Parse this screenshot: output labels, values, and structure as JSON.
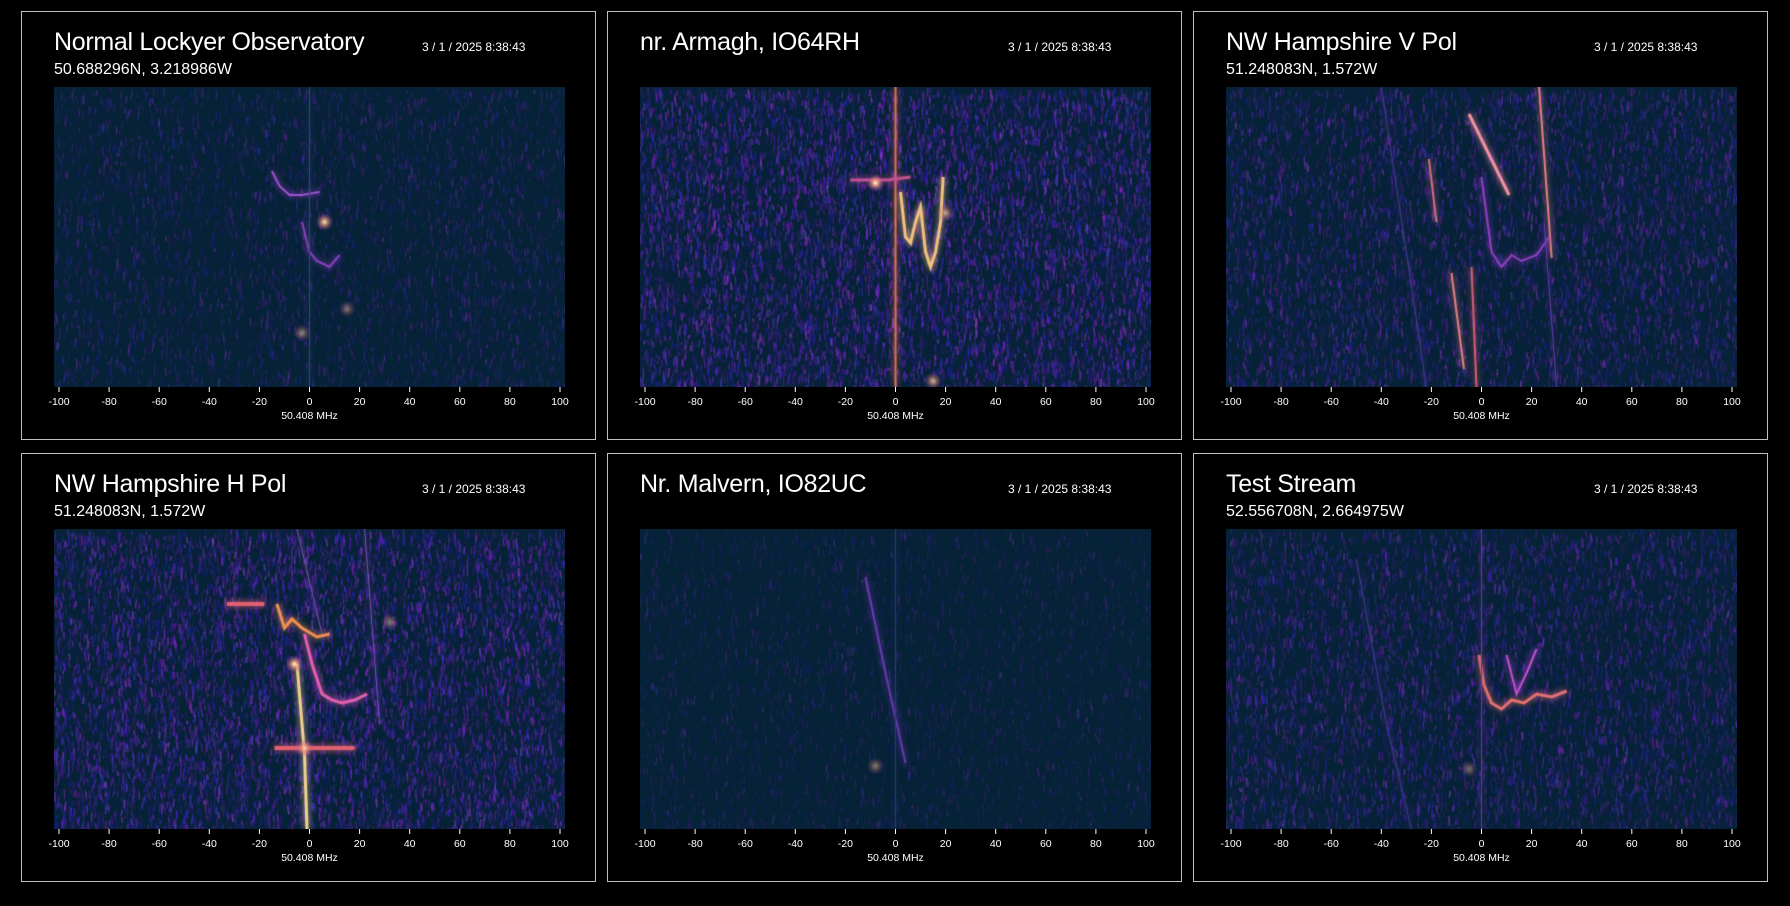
{
  "axis": {
    "ticks": [
      -100,
      -80,
      -60,
      -40,
      -20,
      0,
      20,
      40,
      60,
      80,
      100
    ],
    "xlabel": "50.408 MHz",
    "range": [
      -102,
      102
    ]
  },
  "colors": {
    "background": "#000000",
    "spectrogram_base": "#062236",
    "noise": "#3a2a8a",
    "signal": "#c050e0",
    "hot": "#ffd070"
  },
  "panels": [
    {
      "title": "Normal Lockyer Observatory",
      "coords": "50.688296N, 3.218986W",
      "time": "3 / 1 / 2025  8:38:43",
      "noise_level": 0.25,
      "traces": [
        {
          "points": [
            [
              -15,
              0.28
            ],
            [
              -12,
              0.33
            ],
            [
              -8,
              0.36
            ],
            [
              -3,
              0.36
            ],
            [
              4,
              0.35
            ]
          ],
          "w": 2,
          "c": "#a050d0"
        },
        {
          "points": [
            [
              -3,
              0.45
            ],
            [
              0,
              0.55
            ],
            [
              3,
              0.58
            ],
            [
              8,
              0.6
            ],
            [
              12,
              0.56
            ]
          ],
          "w": 2,
          "c": "#8a40c0"
        },
        {
          "points": [
            [
              0,
              0.0
            ],
            [
              0,
              1.0
            ]
          ],
          "w": 1,
          "c": "#304a7a"
        }
      ],
      "spots": [
        [
          6,
          0.45,
          0.9
        ],
        [
          -3,
          0.82,
          0.5
        ],
        [
          15,
          0.74,
          0.4
        ]
      ]
    },
    {
      "title": "nr. Armagh, IO64RH",
      "coords": "",
      "time": "3 / 1 / 2025  8:38:43",
      "noise_level": 0.9,
      "traces": [
        {
          "points": [
            [
              0,
              0.0
            ],
            [
              0,
              1.0
            ]
          ],
          "w": 2,
          "c": "#e07050"
        },
        {
          "points": [
            [
              2,
              0.35
            ],
            [
              4,
              0.5
            ],
            [
              6,
              0.52
            ],
            [
              8,
              0.45
            ],
            [
              10,
              0.4
            ],
            [
              12,
              0.55
            ],
            [
              14,
              0.6
            ],
            [
              16,
              0.55
            ],
            [
              18,
              0.45
            ],
            [
              19,
              0.3
            ]
          ],
          "w": 3,
          "c": "#f0c080"
        },
        {
          "points": [
            [
              -18,
              0.31
            ],
            [
              -3,
              0.31
            ],
            [
              6,
              0.3
            ]
          ],
          "w": 3,
          "c": "#c05090"
        }
      ],
      "spots": [
        [
          -8,
          0.32,
          1.0
        ],
        [
          20,
          0.42,
          0.6
        ],
        [
          15,
          0.98,
          0.7
        ]
      ]
    },
    {
      "title": "NW Hampshire V Pol",
      "coords": "51.248083N, 1.572W",
      "time": "3 / 1 / 2025  8:38:43",
      "noise_level": 0.55,
      "traces": [
        {
          "points": [
            [
              -5,
              0.09
            ],
            [
              11,
              0.36
            ]
          ],
          "w": 3,
          "c": "#f090a0"
        },
        {
          "points": [
            [
              23,
              0.0
            ],
            [
              28,
              0.57
            ]
          ],
          "w": 2,
          "c": "#e08080"
        },
        {
          "points": [
            [
              -21,
              0.24
            ],
            [
              -18,
              0.45
            ]
          ],
          "w": 2,
          "c": "#d07080"
        },
        {
          "points": [
            [
              -12,
              0.62
            ],
            [
              -7,
              0.94
            ]
          ],
          "w": 2,
          "c": "#e08080"
        },
        {
          "points": [
            [
              -4,
              0.6
            ],
            [
              -2,
              1.0
            ]
          ],
          "w": 2,
          "c": "#d06070"
        },
        {
          "points": [
            [
              0,
              0.3
            ],
            [
              4,
              0.55
            ],
            [
              8,
              0.6
            ],
            [
              12,
              0.56
            ],
            [
              16,
              0.58
            ],
            [
              22,
              0.56
            ],
            [
              27,
              0.5
            ]
          ],
          "w": 2,
          "c": "#9040c0"
        },
        {
          "points": [
            [
              -40,
              0.0
            ],
            [
              -30,
              0.55
            ],
            [
              -22,
              1.0
            ]
          ],
          "w": 1,
          "c": "#4a3a9a"
        },
        {
          "points": [
            [
              25,
              0.45
            ],
            [
              30,
              1.0
            ]
          ],
          "w": 1,
          "c": "#6a3ab0"
        }
      ],
      "spots": []
    },
    {
      "title": "NW Hampshire H Pol",
      "coords": "51.248083N, 1.572W",
      "time": "3 / 1 / 2025  8:38:43",
      "noise_level": 0.85,
      "traces": [
        {
          "points": [
            [
              -5,
              0.45
            ],
            [
              -2,
              0.75
            ],
            [
              -1,
              1.0
            ]
          ],
          "w": 3,
          "c": "#f0d090"
        },
        {
          "points": [
            [
              -13,
              0.25
            ],
            [
              -10,
              0.33
            ],
            [
              -7,
              0.3
            ],
            [
              -3,
              0.33
            ],
            [
              3,
              0.36
            ],
            [
              8,
              0.35
            ]
          ],
          "w": 3,
          "c": "#f09050"
        },
        {
          "points": [
            [
              -2,
              0.35
            ],
            [
              1,
              0.45
            ],
            [
              5,
              0.55
            ],
            [
              9,
              0.57
            ],
            [
              13,
              0.58
            ],
            [
              18,
              0.57
            ],
            [
              23,
              0.55
            ]
          ],
          "w": 3,
          "c": "#e060b0"
        },
        {
          "points": [
            [
              -33,
              0.25
            ],
            [
              -18,
              0.25
            ]
          ],
          "w": 4,
          "c": "#e06070"
        },
        {
          "points": [
            [
              -14,
              0.73
            ],
            [
              18,
              0.73
            ]
          ],
          "w": 4,
          "c": "#e06070"
        },
        {
          "points": [
            [
              -5,
              0.0
            ],
            [
              5,
              0.35
            ]
          ],
          "w": 1,
          "c": "#8050b0"
        },
        {
          "points": [
            [
              22,
              0.0
            ],
            [
              28,
              0.65
            ]
          ],
          "w": 1,
          "c": "#8050b0"
        }
      ],
      "spots": [
        [
          -6,
          0.45,
          1.0
        ],
        [
          -2,
          0.73,
          0.8
        ],
        [
          32,
          0.31,
          0.45
        ]
      ]
    },
    {
      "title": "Nr. Malvern, IO82UC",
      "coords": "",
      "time": "3 / 1 / 2025  8:38:43",
      "noise_level": 0.08,
      "traces": [
        {
          "points": [
            [
              -12,
              0.16
            ],
            [
              -4,
              0.48
            ],
            [
              4,
              0.78
            ]
          ],
          "w": 2,
          "c": "#6a3ab0"
        },
        {
          "points": [
            [
              0,
              0.0
            ],
            [
              0,
              1.0
            ]
          ],
          "w": 1,
          "c": "#2a3a7a"
        }
      ],
      "spots": [
        [
          -8,
          0.79,
          0.45
        ]
      ]
    },
    {
      "title": "Test Stream",
      "coords": "52.556708N, 2.664975W",
      "time": "3 / 1 / 2025  8:38:43",
      "noise_level": 0.55,
      "traces": [
        {
          "points": [
            [
              -1,
              0.42
            ],
            [
              1,
              0.52
            ],
            [
              4,
              0.58
            ],
            [
              8,
              0.6
            ],
            [
              12,
              0.57
            ],
            [
              17,
              0.58
            ],
            [
              22,
              0.55
            ],
            [
              28,
              0.56
            ],
            [
              34,
              0.54
            ]
          ],
          "w": 3,
          "c": "#e07070"
        },
        {
          "points": [
            [
              10,
              0.42
            ],
            [
              14,
              0.55
            ],
            [
              18,
              0.48
            ],
            [
              22,
              0.4
            ]
          ],
          "w": 2,
          "c": "#c050d0"
        },
        {
          "points": [
            [
              0,
              0.0
            ],
            [
              0,
              1.0
            ]
          ],
          "w": 1,
          "c": "#6a3aa0"
        },
        {
          "points": [
            [
              -50,
              0.1
            ],
            [
              -38,
              0.65
            ],
            [
              -28,
              1.0
            ]
          ],
          "w": 1,
          "c": "#4a3a9a"
        }
      ],
      "spots": [
        [
          -5,
          0.8,
          0.4
        ]
      ]
    }
  ]
}
